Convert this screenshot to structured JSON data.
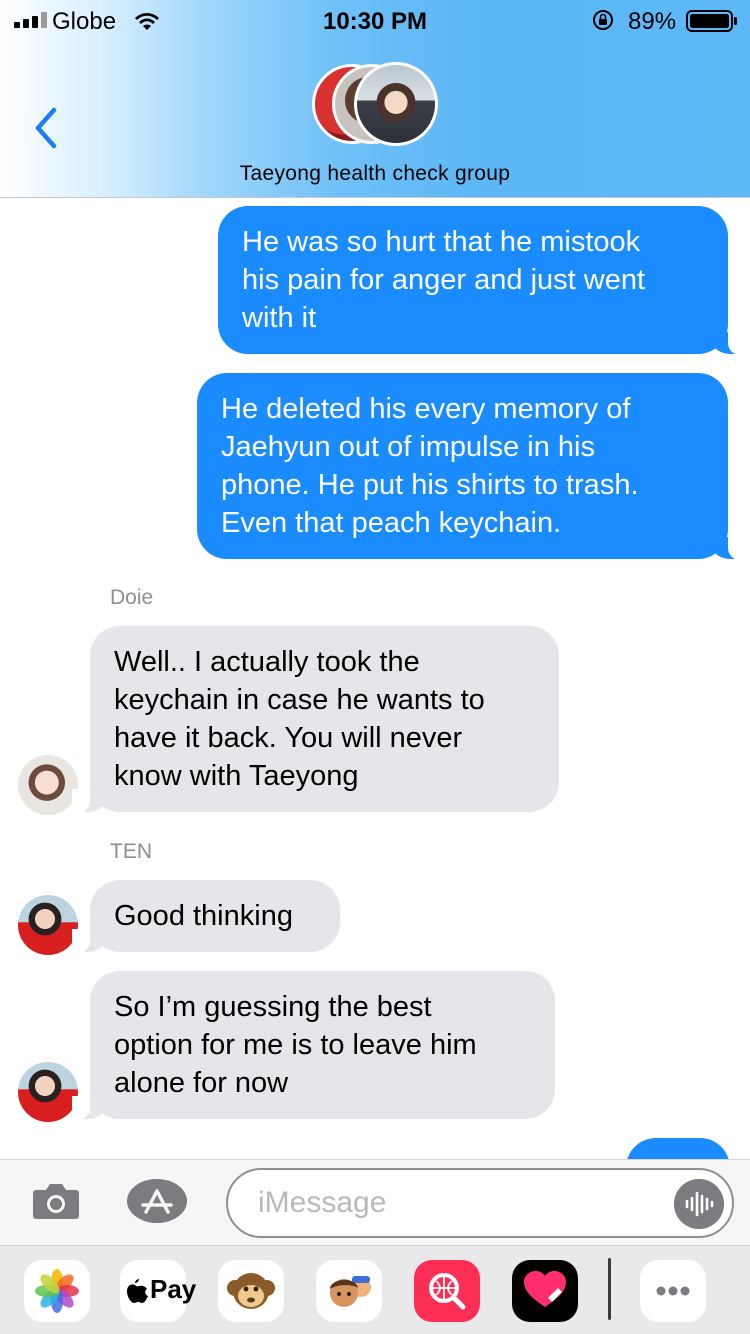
{
  "status_bar": {
    "carrier": "Globe",
    "time": "10:30 PM",
    "battery_percent": "89%",
    "signal_bars": 3,
    "battery_level": 0.89
  },
  "header": {
    "group_name": "Taeyong health check group",
    "avatar_count": 3
  },
  "messages": [
    {
      "direction": "outgoing",
      "text_lines": [
        "He was so hurt that he mistook",
        "his pain for anger and just went",
        "with it"
      ]
    },
    {
      "direction": "outgoing",
      "text_lines": [
        "He deleted his every memory of",
        "Jaehyun out of impulse in his",
        "phone. He put his shirts to trash.",
        "Even that peach keychain."
      ]
    },
    {
      "direction": "incoming",
      "sender": "Doie",
      "text_lines": [
        "Well.. I actually took the",
        "keychain in case he wants to",
        "have it back. You will never",
        "know with Taeyong"
      ]
    },
    {
      "direction": "incoming",
      "sender": "TEN",
      "text_lines": [
        "Good thinking"
      ]
    },
    {
      "direction": "incoming",
      "sender": "TEN",
      "text_lines": [
        "So I’m guessing the best",
        "option for me is to leave him",
        "alone for now"
      ]
    }
  ],
  "input": {
    "placeholder": "iMessage"
  },
  "app_drawer": {
    "apps": [
      "photos-icon",
      "apple-pay-icon",
      "animoji-icon",
      "memoji-icon",
      "search-images-icon",
      "digital-touch-icon",
      "more-icon"
    ],
    "pay_label": "Pay"
  },
  "colors": {
    "outgoing_bubble": "#1a8cff",
    "incoming_bubble": "#e5e5ea",
    "back_chevron": "#1a7ef7"
  }
}
